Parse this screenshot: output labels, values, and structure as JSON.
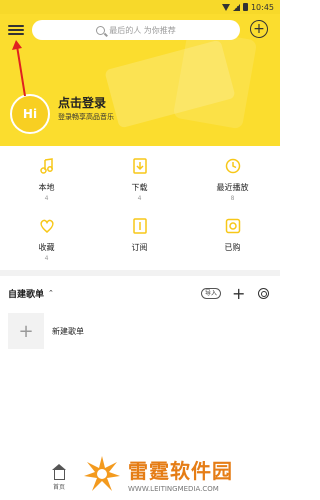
{
  "status_bar": {
    "time": "10:45"
  },
  "header": {
    "search_placeholder": "最后的人 为你推荐",
    "avatar_text": "Hi",
    "login_title": "点击登录",
    "login_subtitle": "登录畅享高品音乐",
    "bg_color": "#fbdd2e"
  },
  "grid": {
    "items": [
      {
        "label": "本地",
        "count": "4",
        "icon": "music-note-icon"
      },
      {
        "label": "下载",
        "count": "4",
        "icon": "download-icon"
      },
      {
        "label": "最近播放",
        "count": "8",
        "icon": "clock-icon"
      },
      {
        "label": "收藏",
        "count": "4",
        "icon": "heart-icon"
      },
      {
        "label": "订阅",
        "count": "",
        "icon": "subscribe-icon"
      },
      {
        "label": "已购",
        "count": "",
        "icon": "purchased-icon"
      }
    ]
  },
  "playlists": {
    "title": "自建歌单",
    "import_label": "导入",
    "new_playlist_label": "新建歌单"
  },
  "bottom_nav": {
    "home_label": "首页"
  },
  "watermark": {
    "brand": "雷霆软件园",
    "url": "WWW.LEITINGMEDIA.COM"
  },
  "colors": {
    "accent": "#f7c718",
    "annotation": "#e02020"
  }
}
